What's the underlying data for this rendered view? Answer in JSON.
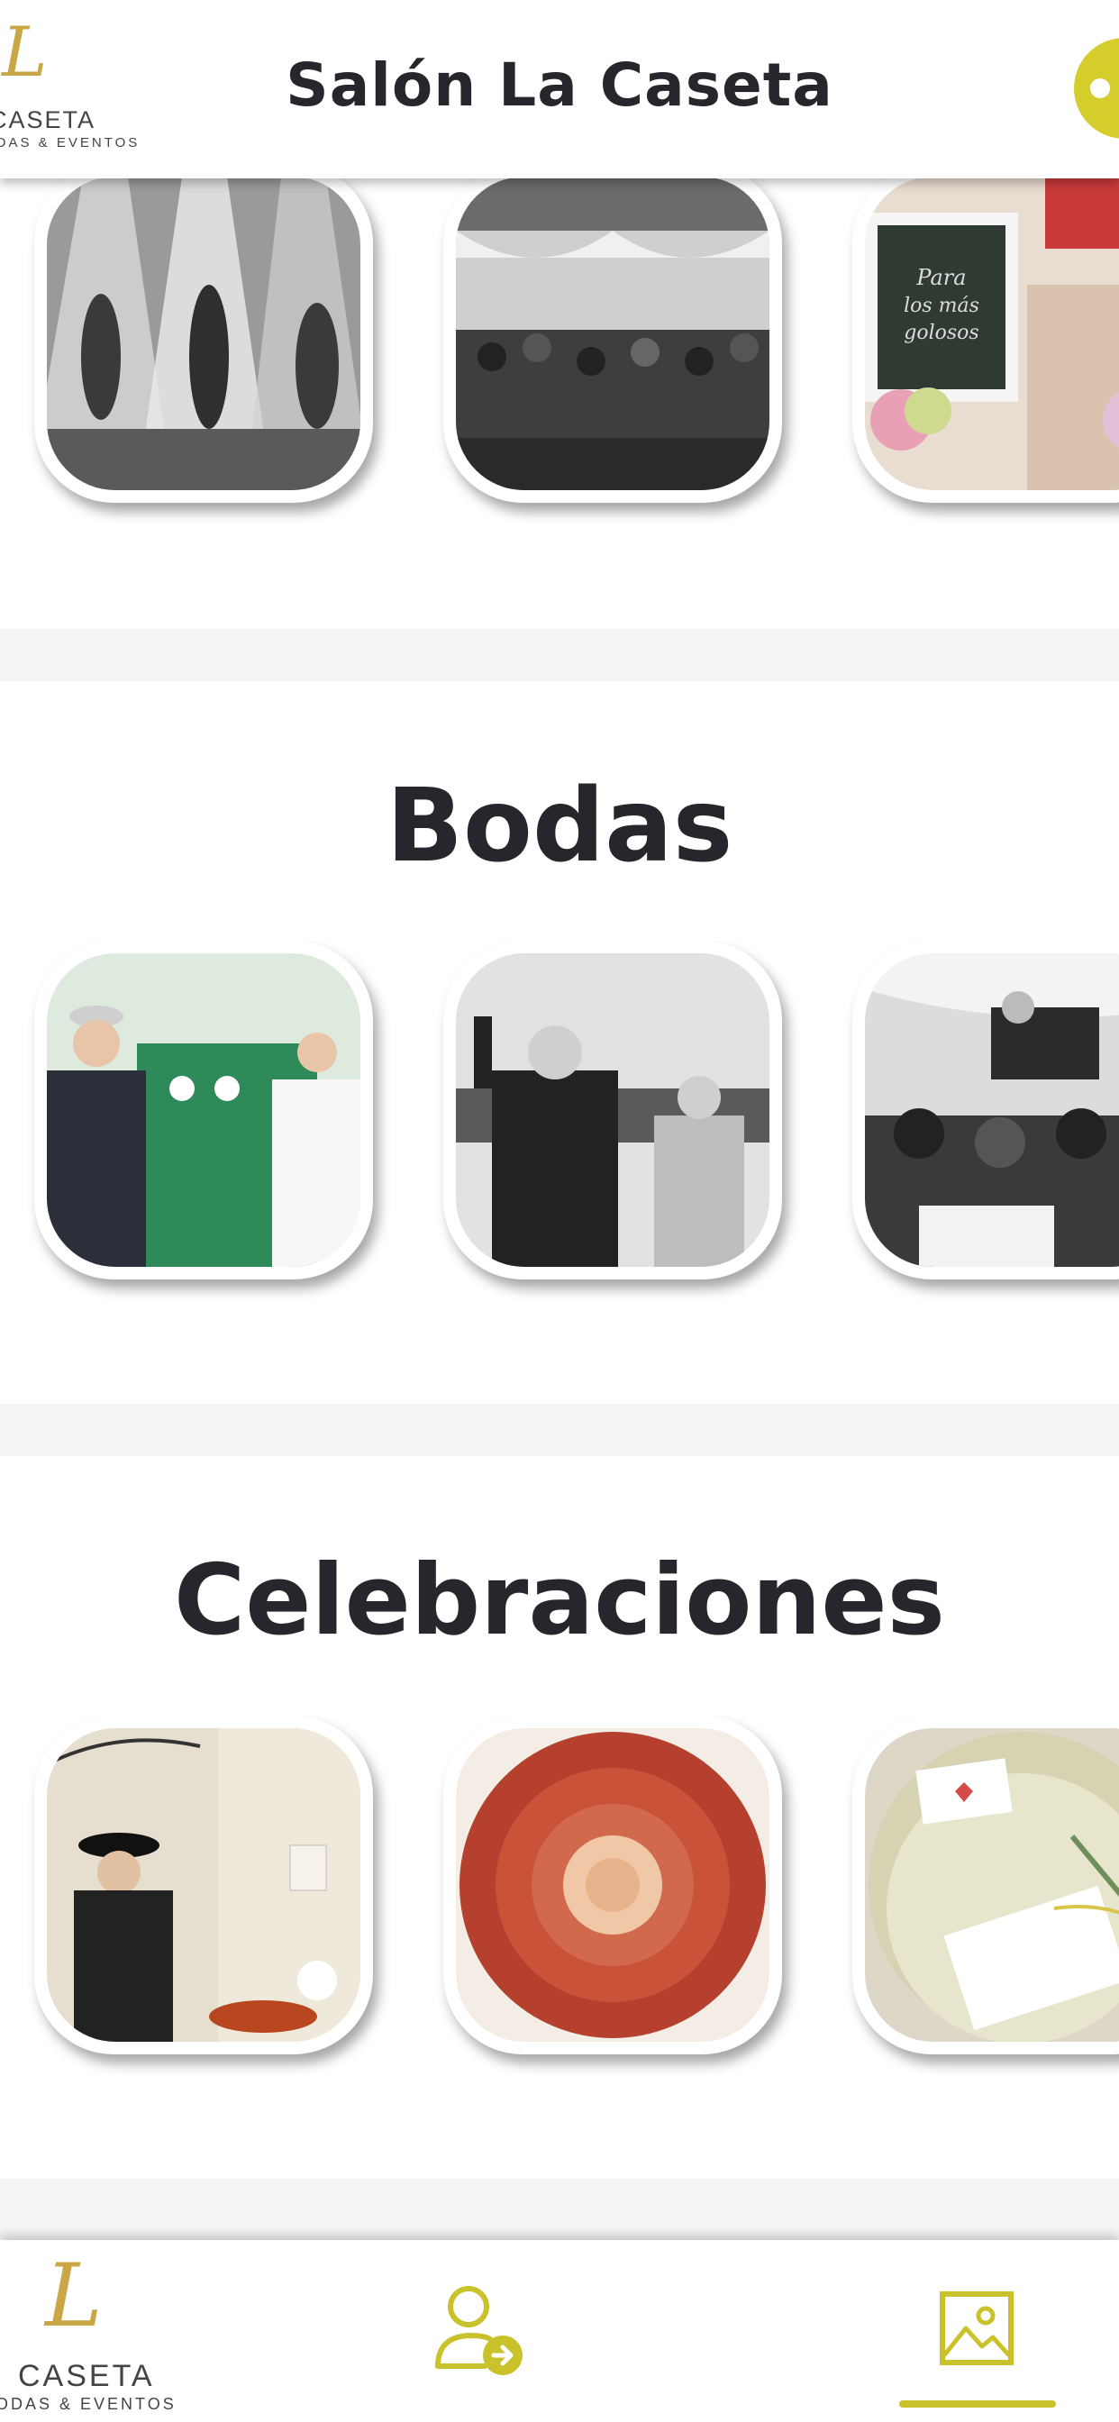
{
  "header": {
    "title": "Salón La Caseta",
    "logo": {
      "script": "L",
      "word": "CASETA",
      "tagline": "BODAS & EVENTOS"
    }
  },
  "sections": [
    {
      "title": "",
      "images": [
        "show-dancers-photo",
        "banquet-hall-crowd-photo",
        "candy-bar-sign-photo"
      ],
      "sign_text": "Para los más golosos"
    },
    {
      "title": "Bodas",
      "images": [
        "groom-bride-dancing-photo",
        "groom-cheering-photo",
        "groom-tossed-photo"
      ]
    },
    {
      "title": "Celebraciones",
      "images": [
        "flamenco-woman-photo",
        "jamon-rose-photo",
        "plate-napkin-photo"
      ]
    }
  ],
  "bottom_nav": {
    "logo": {
      "script": "L",
      "word": "CASETA",
      "tagline": "BODAS & EVENTOS"
    },
    "items": [
      {
        "icon": "user-login-icon"
      },
      {
        "icon": "gallery-icon",
        "active": true
      }
    ]
  },
  "colors": {
    "accent": "#d4cd2b",
    "title": "#25272d",
    "band": "#f5f5f5",
    "logo_gold": "#c9a646"
  }
}
